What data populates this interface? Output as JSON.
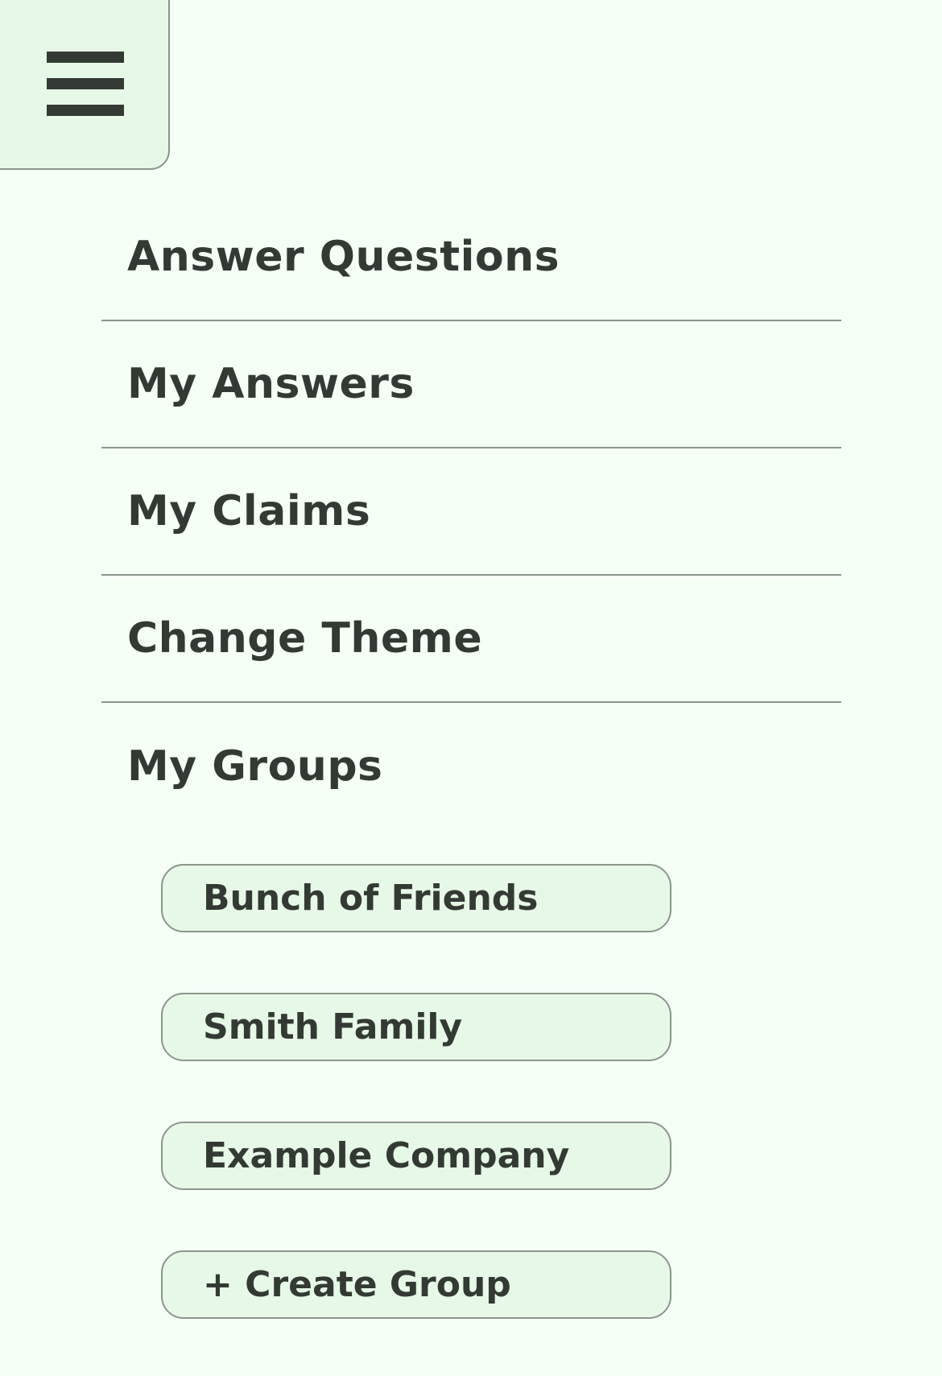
{
  "menu_toggle": {
    "icon": "hamburger-icon"
  },
  "nav": {
    "items": [
      {
        "label": "Answer Questions"
      },
      {
        "label": "My Answers"
      },
      {
        "label": "My Claims"
      },
      {
        "label": "Change Theme"
      },
      {
        "label": "My Groups"
      }
    ]
  },
  "groups": {
    "items": [
      {
        "label": "Bunch of Friends"
      },
      {
        "label": "Smith Family"
      },
      {
        "label": "Example Company"
      }
    ],
    "create_label": "+ Create Group"
  },
  "colors": {
    "background": "#f6fff6",
    "panel": "#e6f9e6",
    "text": "#333a33",
    "border": "#8a968a"
  }
}
